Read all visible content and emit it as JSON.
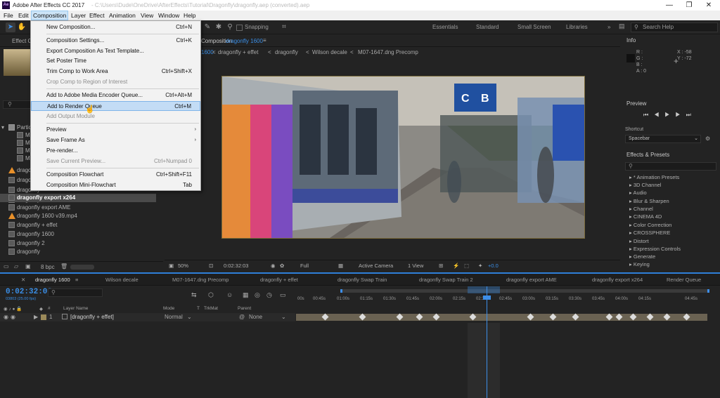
{
  "titlebar": {
    "logo": "Ae",
    "title": "Adobe After Effects CC 2017",
    "path": "- C:\\Users\\Dude\\OneDrive\\AfterEffects\\Tutorial\\Dragonfly\\dragonfly.aep (converted).aep",
    "minimize": "—",
    "maximize": "❐",
    "close": "✕"
  },
  "menubar": [
    "File",
    "Edit",
    "Composition",
    "Layer",
    "Effect",
    "Animation",
    "View",
    "Window",
    "Help"
  ],
  "toolbar": {
    "snapping": "Snapping",
    "workspaces": [
      "Essentials",
      "Standard",
      "Small Screen",
      "Libraries"
    ],
    "workspaces_more": "»",
    "search_help": "Search Help"
  },
  "composition_menu": [
    {
      "label": "New Composition...",
      "shortcut": "Ctrl+N",
      "enabled": true
    },
    {
      "label": "Composition Settings...",
      "shortcut": "Ctrl+K",
      "enabled": true
    },
    {
      "label": "Export Composition As Text Template...",
      "shortcut": "",
      "enabled": true
    },
    {
      "label": "Set Poster Time",
      "shortcut": "",
      "enabled": true
    },
    {
      "label": "Trim Comp to Work Area",
      "shortcut": "Ctrl+Shift+X",
      "enabled": true
    },
    {
      "label": "Crop Comp to Region of Interest",
      "shortcut": "",
      "enabled": false
    },
    {
      "label": "Add to Adobe Media Encoder Queue...",
      "shortcut": "Ctrl+Alt+M",
      "enabled": true
    },
    {
      "label": "Add to Render Queue",
      "shortcut": "Ctrl+M",
      "enabled": true,
      "highlighted": true
    },
    {
      "label": "Add Output Module",
      "shortcut": "",
      "enabled": false
    },
    {
      "label": "Preview",
      "shortcut": "",
      "enabled": true,
      "submenu": true
    },
    {
      "label": "Save Frame As",
      "shortcut": "",
      "enabled": true,
      "submenu": true
    },
    {
      "label": "Pre-render...",
      "shortcut": "",
      "enabled": true
    },
    {
      "label": "Save Current Preview...",
      "shortcut": "Ctrl+Numpad 0",
      "enabled": false
    },
    {
      "label": "Composition Flowchart",
      "shortcut": "Ctrl+Shift+F11",
      "enabled": true
    },
    {
      "label": "Composition Mini-Flowchart",
      "shortcut": "Tab",
      "enabled": true
    }
  ],
  "project": {
    "tab": "Effect C",
    "search_placeholder": "",
    "items": [
      {
        "name": "Partic",
        "icon": "folder"
      },
      {
        "name": "M",
        "icon": "comp"
      },
      {
        "name": "M",
        "icon": "comp"
      },
      {
        "name": "M",
        "icon": "comp"
      },
      {
        "name": "M",
        "icon": "comp"
      },
      {
        "name": "dragonfly",
        "icon": "cone"
      },
      {
        "name": "dragonfly",
        "icon": "comp"
      },
      {
        "name": "dragonfly",
        "icon": "comp"
      },
      {
        "name": "dragonfly",
        "icon": "comp"
      },
      {
        "name": "dragonfly export x264",
        "icon": "comp",
        "selected": true
      },
      {
        "name": "dragonfly export AME",
        "icon": "comp"
      },
      {
        "name": "dragonfly 1600 v39.mp4",
        "icon": "cone"
      },
      {
        "name": "dragonfly + effet",
        "icon": "comp"
      },
      {
        "name": "dragonfly 1600",
        "icon": "comp"
      },
      {
        "name": "dragonfly 2",
        "icon": "comp"
      },
      {
        "name": "dragonfly",
        "icon": "comp"
      }
    ],
    "bpc": "8 bpc"
  },
  "viewer": {
    "tab_prefix": "Composition",
    "tab_name": "dragonfly 1600",
    "breadcrumbs": [
      "1600",
      "dragonfly + effet",
      "dragonfly",
      "Wilson decale",
      "M07-1647.dng Precomp"
    ],
    "zoom": "50%",
    "timecode": "0:02:32:03",
    "resolution": "Full",
    "camera": "Active Camera",
    "view": "1 View",
    "exposure": "+0.0"
  },
  "right": {
    "info": "Info",
    "info_vals": {
      "r": "R :",
      "g": "G :",
      "b": "B :",
      "a": "A : 0",
      "x": "X : -58",
      "y": "Y : -72"
    },
    "preview": "Preview",
    "shortcut_label": "Shortcut",
    "shortcut_value": "Spacebar",
    "effects_presets": "Effects & Presets",
    "effects": [
      "* Animation Presets",
      "3D Channel",
      "Audio",
      "Blur & Sharpen",
      "Channel",
      "CINEMA 4D",
      "Color Correction",
      "CROSSPHERE",
      "Distort",
      "Expression Controls",
      "Generate",
      "Keying"
    ]
  },
  "timeline": {
    "tabs": [
      "dragonfly 1600",
      "Wilson decale",
      "M07-1647.dng Precomp",
      "dragonfly + effet",
      "dragonfly Swap Train",
      "dragonfly Swap Train 2",
      "dragonfly export AME",
      "dragonfly export x264",
      "Render Queue"
    ],
    "timecode": "0:02:32:03",
    "fps": "03803 (25.00 fps)",
    "columns": [
      "Layer Name",
      "Mode",
      "T",
      "TrkMat",
      "Parent"
    ],
    "layer": {
      "index": "1",
      "name": "[dragonfly + effet]",
      "mode": "Normal",
      "parent": "None"
    },
    "ruler": [
      "00s",
      "00:45s",
      "01:00s",
      "01:15s",
      "01:30s",
      "01:45s",
      "02:00s",
      "02:15s",
      "02:30s",
      "02:45s",
      "03:00s",
      "03:15s",
      "03:30s",
      "03:45s",
      "04:00s",
      "04:15s",
      "04:45s"
    ]
  }
}
